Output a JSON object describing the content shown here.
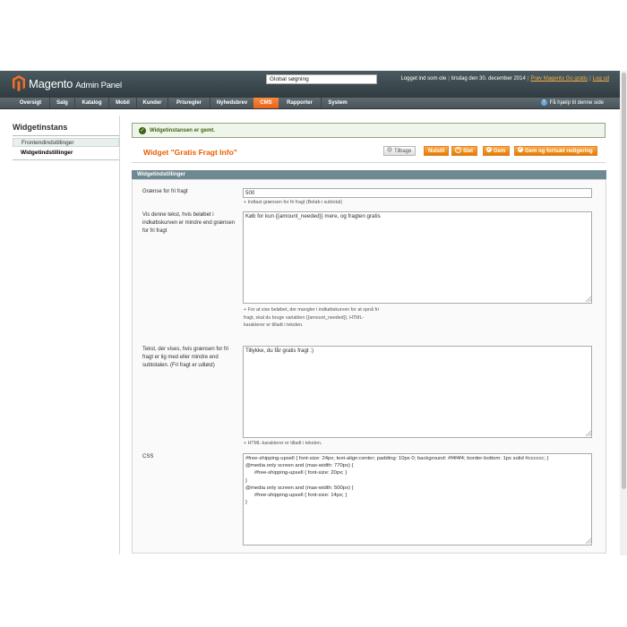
{
  "header": {
    "logo_text": "Magento",
    "logo_sub": "Admin Panel",
    "search_value": "Global søgning",
    "logged_in": "Logget ind som ole",
    "date": "tirsdag den 30. december 2014",
    "try_link": "Prøv Magento Go gratis",
    "logout": "Log ud"
  },
  "nav": {
    "items": [
      "Oversigt",
      "Salg",
      "Katalog",
      "Mobil",
      "Kunder",
      "Prisregler",
      "Nyhedsbrev",
      "CMS",
      "Rapporter",
      "System"
    ],
    "active": "CMS",
    "help": "Få hjælp til denne side"
  },
  "sidebar": {
    "title": "Widgetinstans",
    "tabs": [
      "Frontendindstillinger",
      "Widgetindstillinger"
    ]
  },
  "message": "Widgetinstansen er gemt.",
  "page": {
    "title": "Widget \"Gratis Fragt Info\"",
    "buttons": {
      "back": "Tilbage",
      "reset": "Nulstil",
      "delete": "Slet",
      "save": "Gem",
      "save_continue": "Gem og fortsæt redigering"
    }
  },
  "fieldset": {
    "title": "Widgetindstillinger",
    "threshold_label": "Grænse for fri fragt",
    "threshold_value": "500",
    "threshold_note": "Indtast grænsen for fri fragt (Beløb i subtotal)",
    "below_label": "Vis denne tekst, hvis beløbet i indkøbskurven er mindre end grænsen for fri fragt",
    "below_value": "Køb for kun {{amount_needed}} mere, og fragten gratis",
    "below_note": "For at vise beløbet, der mangler i indkøbskurven for at opnå fri fragt, skal du bruge variablen {{amount_needed}}. HTML-karakterer er tilladt i teksten.",
    "reached_label": "Tekst, der vises, hvis grænsen for fri fragt er lig med eller mindre end subtotalen. (Fri fragt er udløst)",
    "reached_value": "Tillykke, du får gratis fragt :)",
    "reached_note": "HTML-karakterer er tilladt i teksten.",
    "css_label": "CSS",
    "css_value": "#free-shipping-upsell { font-size: 24px; text-align:center; padding: 10px 0; background: #f4f4f4; border-bottom: 1px solid #cccccc; }\n@media only screen and (max-width: 770px) {\n      #free-shipping-upsell { font-size: 20px; }\n}\n@media only screen and (max-width: 500px) {\n      #free-shipping-upsell { font-size: 14px; }\n}"
  },
  "colors": {
    "accent": "#eb5e00",
    "header_bg": "#3c4a4e",
    "nav_active": "#f36e2a",
    "button": "#f18200",
    "fieldset_head": "#6f8992",
    "success": "#3d6611"
  }
}
